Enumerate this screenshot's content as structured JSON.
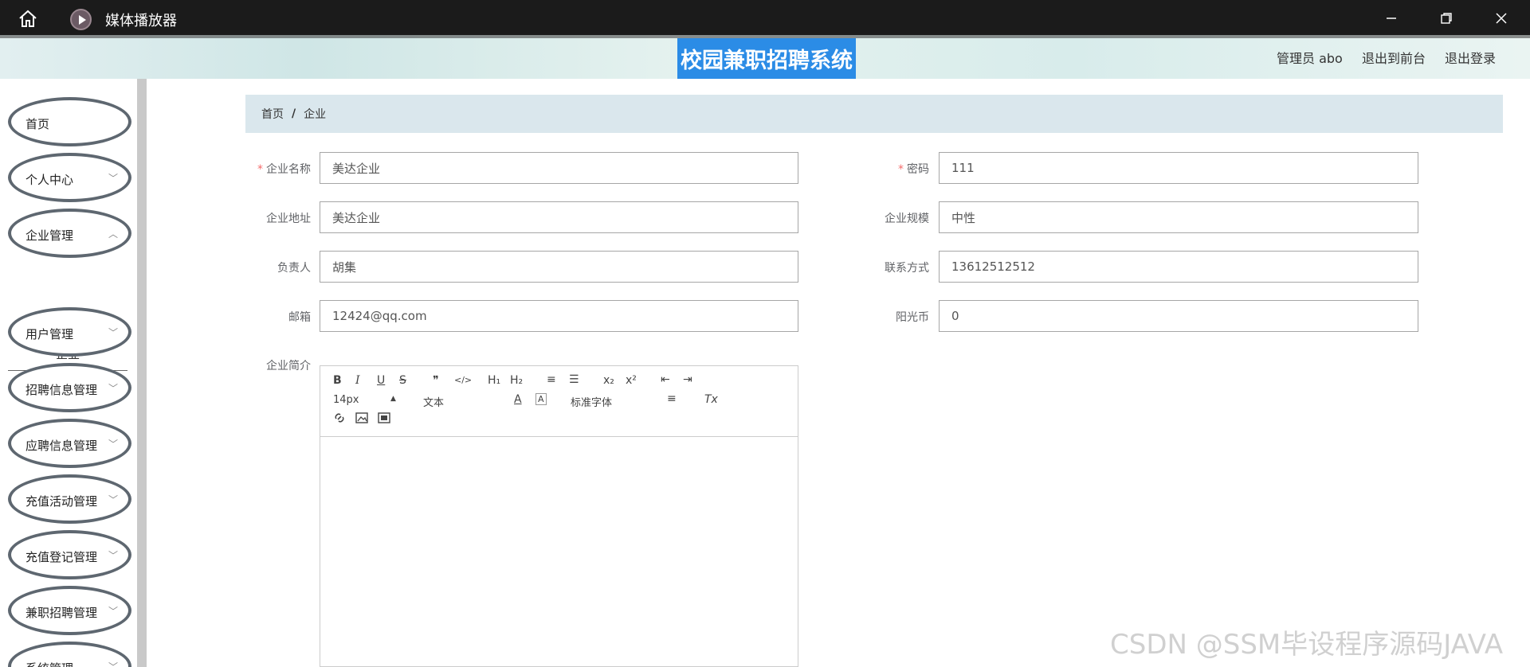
{
  "window": {
    "title": "媒体播放器",
    "icons": {
      "home": "home-icon",
      "app": "media-player-icon",
      "minimize": "minimize-icon",
      "maximize": "restore-icon",
      "close": "close-icon"
    }
  },
  "header": {
    "title": "校园兼职招聘系统",
    "user": "管理员 abo",
    "to_front": "退出到前台",
    "logout": "退出登录"
  },
  "sidebar": {
    "items": [
      {
        "label": "首页",
        "has_chevron": false
      },
      {
        "label": "个人中心",
        "has_chevron": true
      },
      {
        "label": "企业管理",
        "has_chevron": true
      },
      {
        "label": "用户管理",
        "has_chevron": true
      },
      {
        "label": "招聘信息管理",
        "has_chevron": true
      },
      {
        "label": "应聘信息管理",
        "has_chevron": true
      },
      {
        "label": "充值活动管理",
        "has_chevron": true
      },
      {
        "label": "充值登记管理",
        "has_chevron": true
      },
      {
        "label": "兼职招聘管理",
        "has_chevron": true
      },
      {
        "label": "系统管理",
        "has_chevron": true
      }
    ],
    "sub_item": "企业"
  },
  "breadcrumb": {
    "home": "首页",
    "sep": "/",
    "current": "企业"
  },
  "form": {
    "company_name": {
      "label": "企业名称",
      "value": "美达企业",
      "required": true
    },
    "password": {
      "label": "密码",
      "value": "111",
      "required": true
    },
    "address": {
      "label": "企业地址",
      "value": "美达企业"
    },
    "scale": {
      "label": "企业规模",
      "value": "中性"
    },
    "manager": {
      "label": "负责人",
      "value": "胡集"
    },
    "contact": {
      "label": "联系方式",
      "value": "13612512512"
    },
    "email": {
      "label": "邮箱",
      "value": "12424@qq.com"
    },
    "sunshine": {
      "label": "阳光币",
      "value": "0"
    },
    "intro": {
      "label": "企业简介"
    }
  },
  "editor": {
    "buttons": {
      "bold": "B",
      "italic": "I",
      "underline": "U",
      "strike": "S",
      "quote": "❞",
      "code": "</>",
      "h1": "H₁",
      "h2": "H₂",
      "ordered": "≡",
      "bullet": "☰",
      "sub": "x₂",
      "sup": "x²",
      "outdent": "⇤",
      "indent": "⇥"
    },
    "size": "14px",
    "header": "文本",
    "font": "标准字体",
    "color_btn": "A",
    "bg_btn": "A",
    "align_btn": "≡",
    "clean_btn": "Tx"
  },
  "watermark": "CSDN @SSM毕设程序源码JAVA"
}
